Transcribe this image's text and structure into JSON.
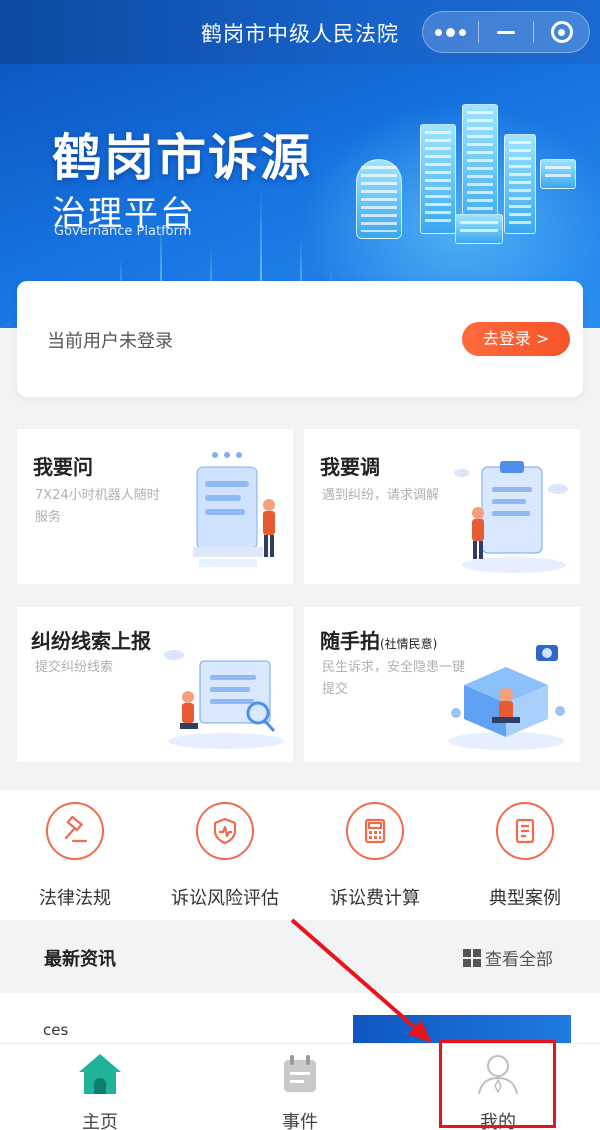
{
  "header": {
    "title": "鹤岗市中级人民法院"
  },
  "banner": {
    "title_line1": "鹤岗市诉源",
    "title_line2": "治理平台",
    "title_en": "Governance Platform"
  },
  "login": {
    "status_text": "当前用户未登录",
    "button_label": "去登录 >"
  },
  "services": [
    {
      "title": "我要问",
      "desc": "7X24小时机器人随时服务"
    },
    {
      "title": "我要调",
      "desc": "遇到纠纷，请求调解"
    },
    {
      "title": "纠纷线索上报",
      "desc": "提交纠纷线索"
    },
    {
      "title": "随手拍",
      "title_suffix": "(社情民意)",
      "desc": "民生诉求，安全隐患一键提交"
    }
  ],
  "quick_links": [
    {
      "label": "法律法规",
      "icon": "gavel-icon"
    },
    {
      "label": "诉讼风险评估",
      "icon": "shield-icon"
    },
    {
      "label": "诉讼费计算",
      "icon": "calculator-icon"
    },
    {
      "label": "典型案例",
      "icon": "document-icon"
    }
  ],
  "news": {
    "section_title": "最新资讯",
    "view_all": "查看全部",
    "items": [
      {
        "title": "ces"
      }
    ]
  },
  "tabbar": {
    "items": [
      {
        "label": "主页",
        "icon": "home-icon",
        "active": true
      },
      {
        "label": "事件",
        "icon": "calendar-icon",
        "active": false
      },
      {
        "label": "我的",
        "icon": "user-icon",
        "active": false
      }
    ]
  },
  "colors": {
    "brand_blue": "#1762c8",
    "accent_orange": "#f5532a",
    "home_green": "#1fb39a",
    "annotation_red": "#e8141b"
  }
}
